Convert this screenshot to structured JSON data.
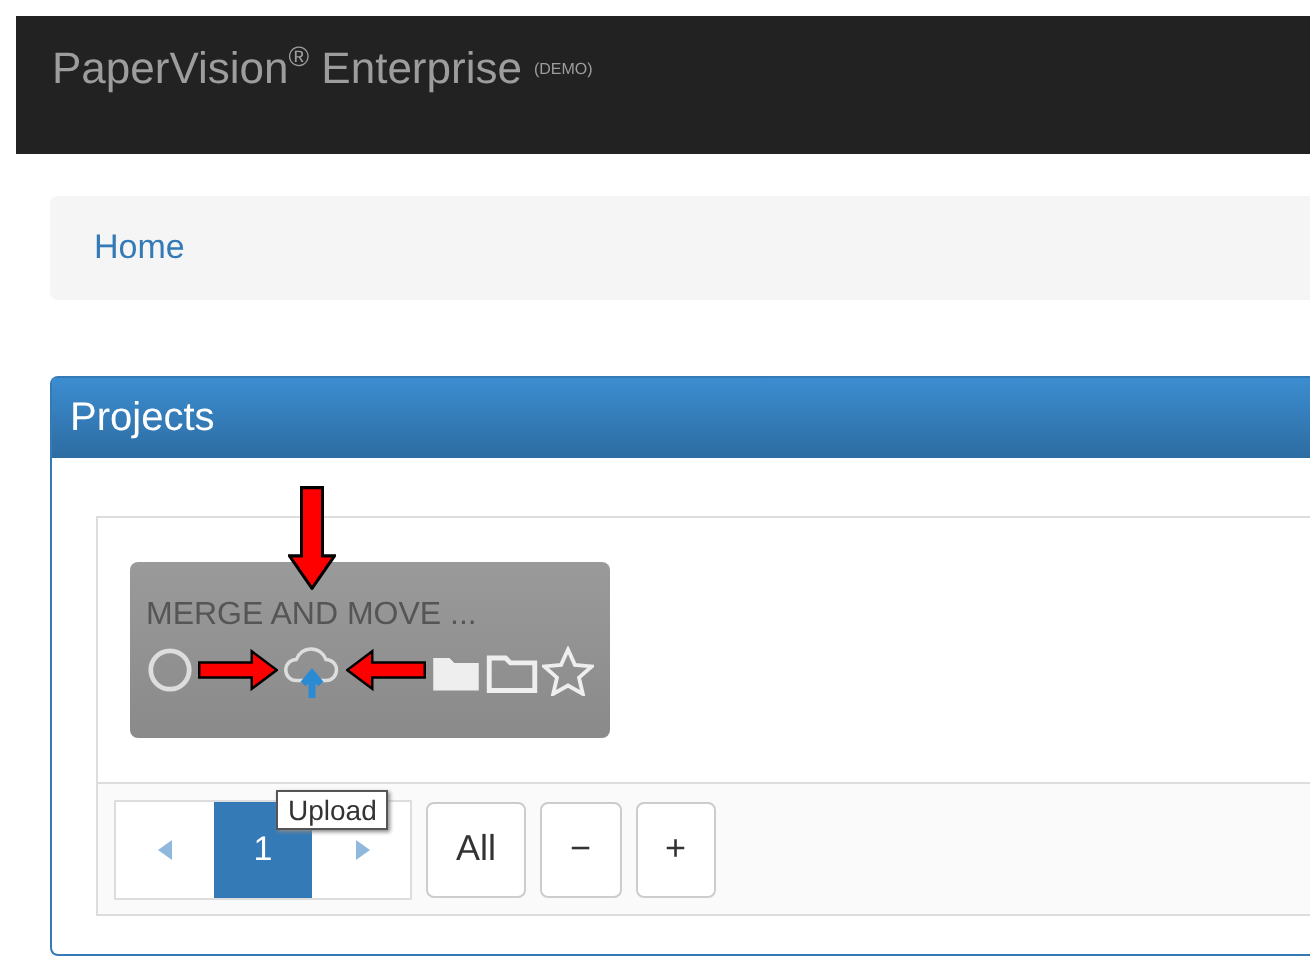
{
  "navbar": {
    "brand": "PaperVision",
    "brand_mark": "®",
    "product": "Enterprise",
    "badge": "(DEMO)"
  },
  "breadcrumb": [
    "Home"
  ],
  "panel": {
    "title": "Projects",
    "cards": [
      {
        "title": "MERGE AND MOVE ..."
      }
    ],
    "tooltip": "Upload",
    "pager": {
      "pages": [
        {
          "label": "1",
          "selected": true
        }
      ],
      "buttons": [
        "All",
        "−",
        "+"
      ]
    }
  }
}
